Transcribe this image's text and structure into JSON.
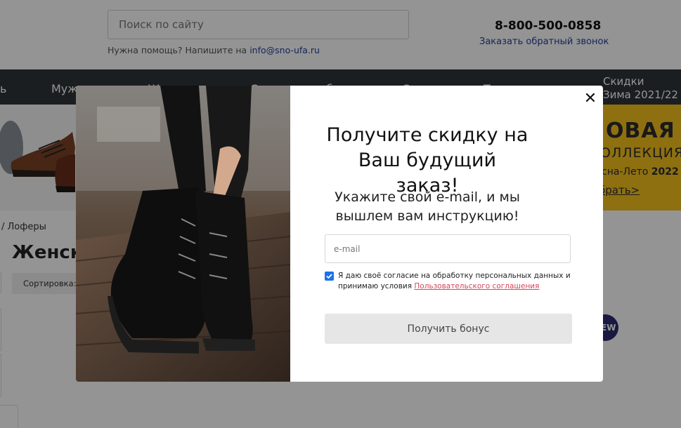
{
  "header": {
    "search_placeholder": "Поиск по сайту",
    "help_prefix": "Нужна помощь? Напишите на ",
    "help_email": "info@sno-ufa.ru",
    "phone": "8-800-500-0858",
    "callback_label": "Заказать обратный звонок"
  },
  "nav": {
    "items": [
      "ь",
      "Муж",
      "Ж",
      "С",
      "б",
      "С",
      "Т"
    ],
    "sale_line1": "Скидки",
    "sale_line2": "Зима 2021/22"
  },
  "promo": {
    "line1": "ОВАЯ",
    "line2": "ОЛЛЕКЦИЯ",
    "line3_prefix": "сна-Лето ",
    "line3_year": "2022",
    "link": "брать>"
  },
  "content": {
    "breadcrumb": "/  Лоферы",
    "title": "Женски",
    "sort_label": "Сортировка: ",
    "badge": "EW"
  },
  "modal": {
    "title": "Получите скидку на Ваш будущий заказ!",
    "subtitle": "Укажите свой e-mail, и мы вышлем вам инструкцию!",
    "email_placeholder": "e-mail",
    "consent_checked": true,
    "consent_text": "Я даю своё согласие на обработку персональных данных и принимаю условия ",
    "consent_link": "Пользовательского соглашения",
    "submit_label": "Получить бонус",
    "close_symbol": "✕"
  },
  "colors": {
    "navbar": "#2f3439",
    "link_blue": "#25409a",
    "promo_yellow": "#f4c21e",
    "consent_link": "#d3455b",
    "checkbox": "#1a73e8"
  }
}
